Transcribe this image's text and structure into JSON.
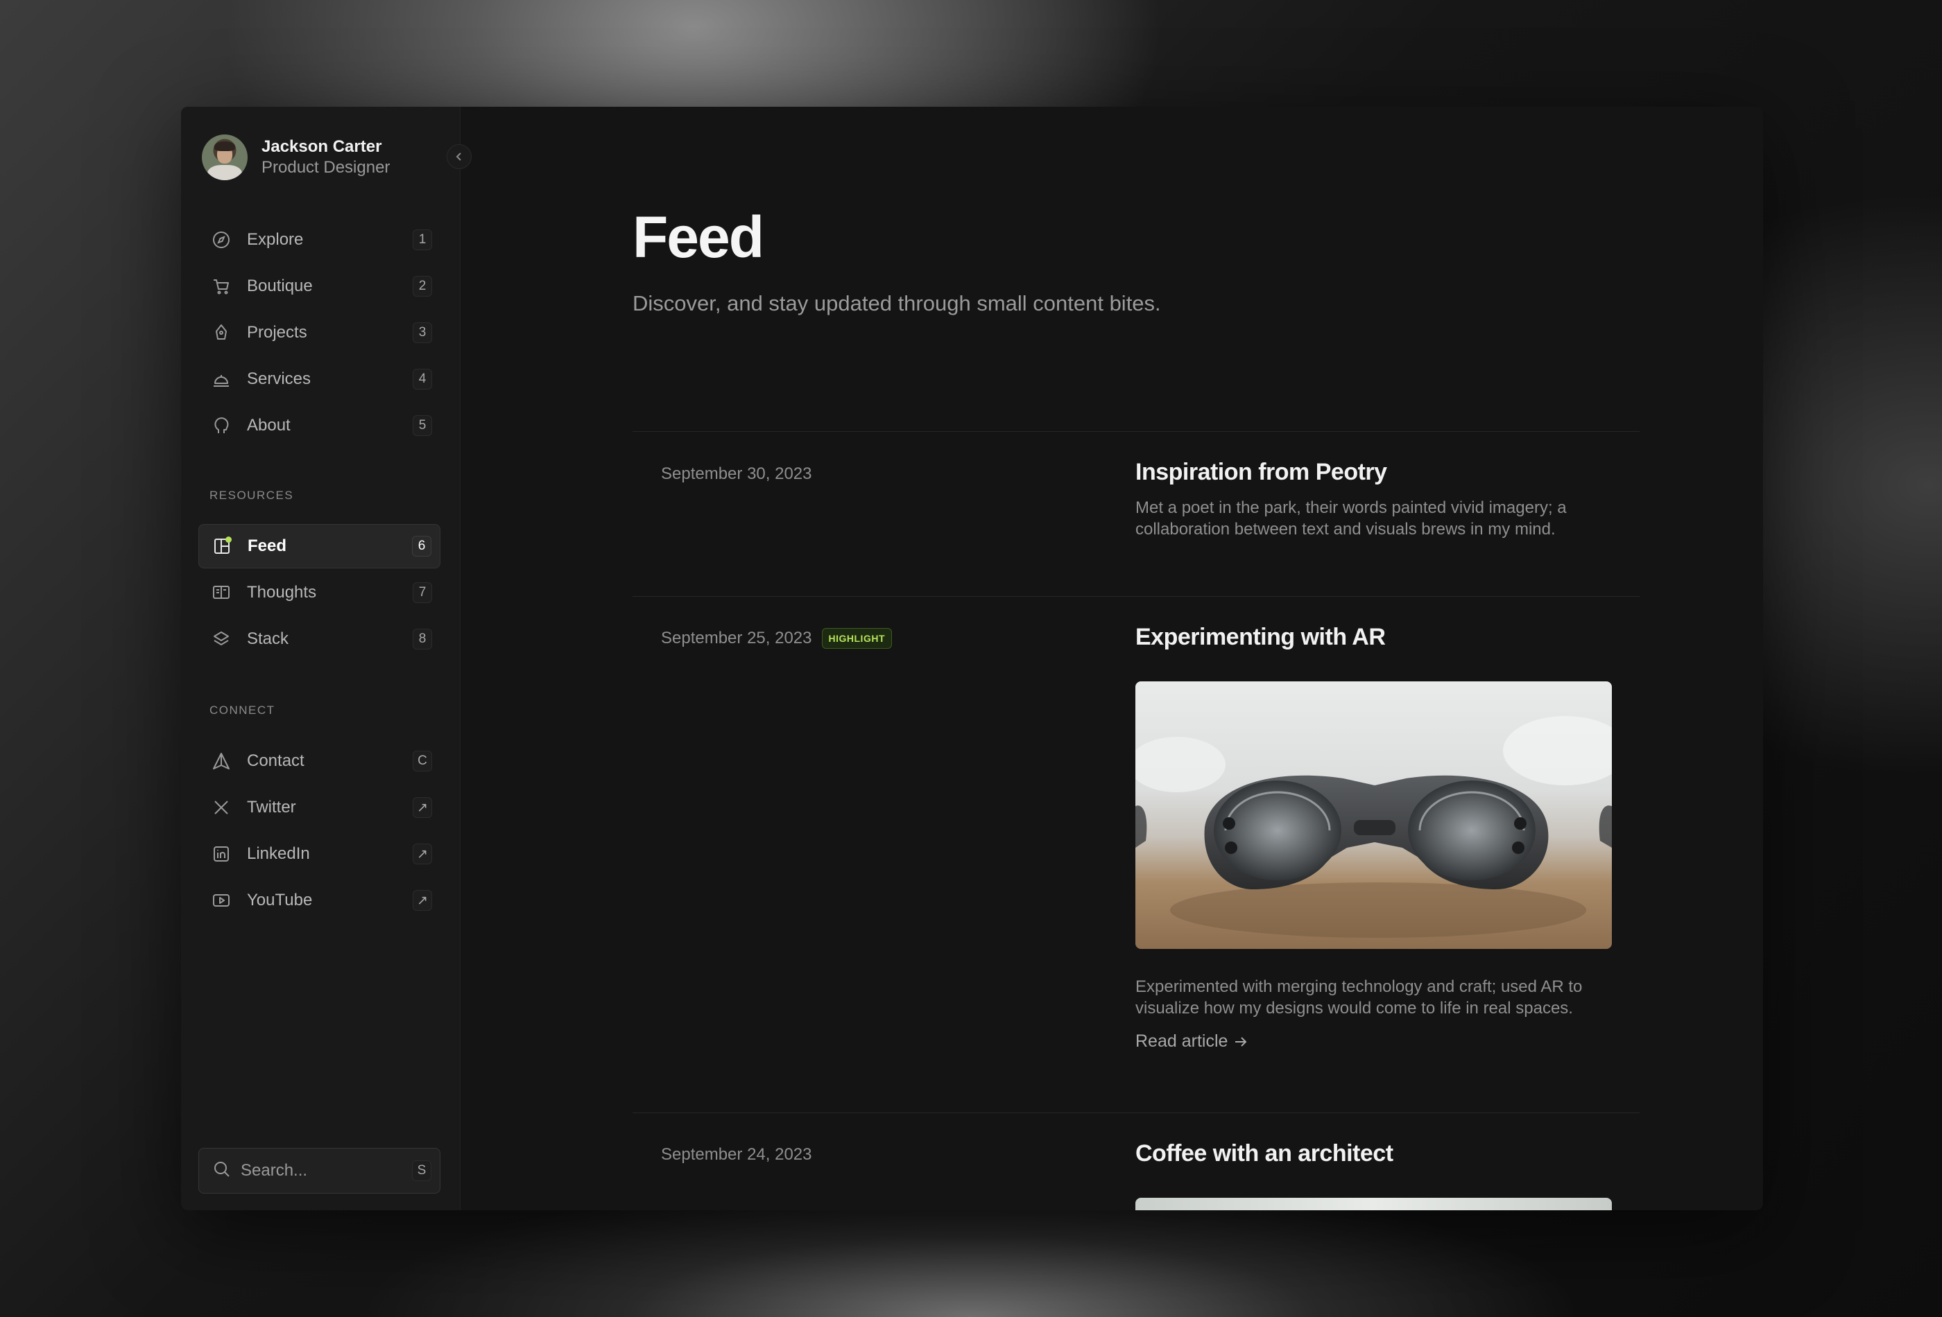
{
  "profile": {
    "name": "Jackson Carter",
    "role": "Product Designer"
  },
  "nav": {
    "primary": [
      {
        "label": "Explore",
        "shortcut": "1",
        "icon": "compass-icon"
      },
      {
        "label": "Boutique",
        "shortcut": "2",
        "icon": "cart-icon"
      },
      {
        "label": "Projects",
        "shortcut": "3",
        "icon": "pen-nib-icon"
      },
      {
        "label": "Services",
        "shortcut": "4",
        "icon": "service-bell-icon"
      },
      {
        "label": "About",
        "shortcut": "5",
        "icon": "head-icon"
      }
    ],
    "resources_heading": "RESOURCES",
    "resources": [
      {
        "label": "Feed",
        "shortcut": "6",
        "icon": "feed-grid-icon",
        "active": true
      },
      {
        "label": "Thoughts",
        "shortcut": "7",
        "icon": "book-open-icon"
      },
      {
        "label": "Stack",
        "shortcut": "8",
        "icon": "layers-icon"
      }
    ],
    "connect_heading": "CONNECT",
    "connect": [
      {
        "label": "Contact",
        "shortcut": "C",
        "icon": "send-icon"
      },
      {
        "label": "Twitter",
        "shortcut": "↗",
        "icon": "x-logo-icon"
      },
      {
        "label": "LinkedIn",
        "shortcut": "↗",
        "icon": "linkedin-icon"
      },
      {
        "label": "YouTube",
        "shortcut": "↗",
        "icon": "youtube-icon"
      }
    ]
  },
  "search": {
    "placeholder": "Search...",
    "shortcut": "S"
  },
  "page": {
    "title": "Feed",
    "subtitle": "Discover, and stay updated through small content bites."
  },
  "entries": [
    {
      "date": "September 30, 2023",
      "title": "Inspiration from Peotry",
      "body": "Met a poet in the park, their words painted vivid imagery; a collaboration between text and visuals brews in my mind."
    },
    {
      "date": "September 25, 2023",
      "badge": "HIGHLIGHT",
      "title": "Experimenting with AR",
      "body": "Experimented with merging technology and craft; used AR to visualize how my designs would come to life in real spaces.",
      "link": "Read article"
    },
    {
      "date": "September 24, 2023",
      "title": "Coffee with an architect"
    }
  ],
  "colors": {
    "accent": "#b6e35a",
    "background": "#141414",
    "sidebar": "#191919"
  }
}
